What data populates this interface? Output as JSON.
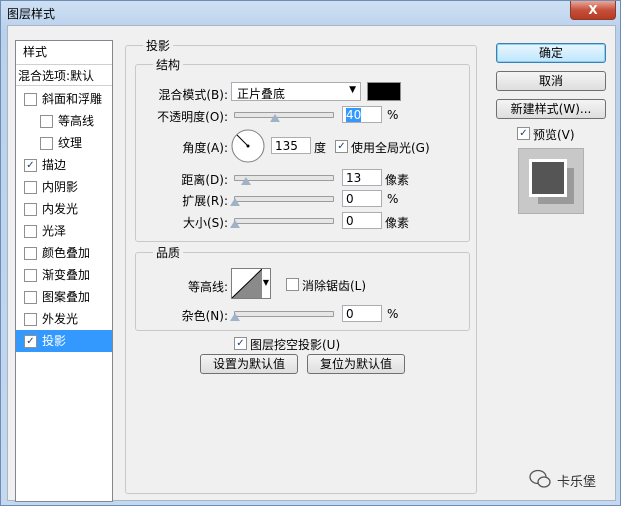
{
  "window": {
    "title": "图层样式",
    "close_label": "X"
  },
  "styles": {
    "header": "样式",
    "blending": "混合选项:默认",
    "items": [
      {
        "label": "斜面和浮雕",
        "checked": false
      },
      {
        "label": "等高线",
        "checked": false
      },
      {
        "label": "纹理",
        "checked": false
      },
      {
        "label": "描边",
        "checked": true
      },
      {
        "label": "内阴影",
        "checked": false
      },
      {
        "label": "内发光",
        "checked": false
      },
      {
        "label": "光泽",
        "checked": false
      },
      {
        "label": "颜色叠加",
        "checked": false
      },
      {
        "label": "渐变叠加",
        "checked": false
      },
      {
        "label": "图案叠加",
        "checked": false
      },
      {
        "label": "外发光",
        "checked": false
      },
      {
        "label": "投影",
        "checked": true
      }
    ]
  },
  "shadow": {
    "section_title": "投影",
    "structure_title": "结构",
    "blend_mode_label": "混合模式(B):",
    "blend_mode_value": "正片叠底",
    "shadow_color": "#000000",
    "opacity_label": "不透明度(O):",
    "opacity_value": "40",
    "opacity_unit": "%",
    "angle_label": "角度(A):",
    "angle_value": "135",
    "angle_unit": "度",
    "global_light_label": "使用全局光(G)",
    "global_light_checked": true,
    "distance_label": "距离(D):",
    "distance_value": "13",
    "distance_unit": "像素",
    "spread_label": "扩展(R):",
    "spread_value": "0",
    "spread_unit": "%",
    "size_label": "大小(S):",
    "size_value": "0",
    "size_unit": "像素",
    "quality_title": "品质",
    "contour_label": "等高线:",
    "antialias_label": "消除锯齿(L)",
    "antialias_checked": false,
    "noise_label": "杂色(N):",
    "noise_value": "0",
    "noise_unit": "%",
    "knockout_label": "图层挖空投影(U)",
    "knockout_checked": true,
    "make_default_label": "设置为默认值",
    "reset_default_label": "复位为默认值"
  },
  "buttons": {
    "ok": "确定",
    "cancel": "取消",
    "new_style": "新建样式(W)...",
    "preview_label": "预览(V)",
    "preview_checked": true
  },
  "watermark": "卡乐堡",
  "check_glyph": "✓"
}
